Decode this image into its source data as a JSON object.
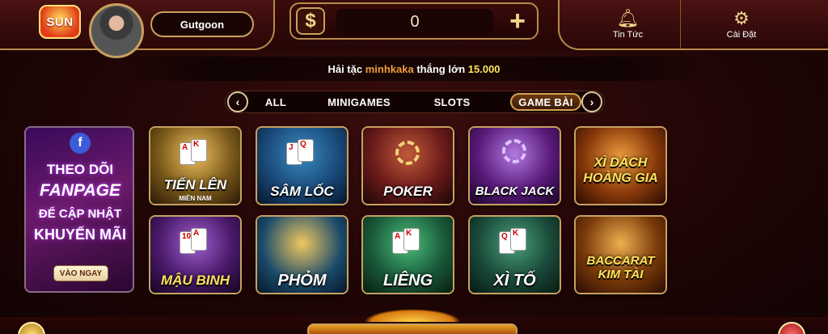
{
  "header": {
    "logo_text": "SUN",
    "username": "Gutgoon",
    "balance": "0",
    "currency_symbol": "$",
    "add_symbol": "+",
    "news_label": "Tin Tức",
    "settings_label": "Cài Đặt"
  },
  "ticker": {
    "prefix": "Hải tặc",
    "player": "minhkaka",
    "verb": "thắng lớn",
    "amount": "15.000"
  },
  "tabs": {
    "prev_symbol": "‹",
    "next_symbol": "›",
    "items": [
      {
        "label": "ALL"
      },
      {
        "label": "MINIGAMES"
      },
      {
        "label": "SLOTS"
      },
      {
        "label": "GAME BÀI",
        "active": true
      }
    ]
  },
  "promo": {
    "fb_letter": "f",
    "line1": "THEO DÕI",
    "line2": "FANPAGE",
    "line3": "ĐỂ CẬP NHẬT",
    "line4": "KHUYẾN MÃI",
    "button": "VÀO NGAY"
  },
  "games": [
    {
      "title": "TIẾN LÊN",
      "subtitle": "MIỀN NAM",
      "color": "#7a5a1a"
    },
    {
      "title": "SÂM LỐC",
      "subtitle": "",
      "color": "#1a4a7a"
    },
    {
      "title": "POKER",
      "subtitle": "",
      "color": "#6a1a1a"
    },
    {
      "title": "BLACK JACK",
      "subtitle": "",
      "color": "#5a1a7a"
    },
    {
      "title": "XÌ DÁCH HOÀNG GIA",
      "subtitle": "",
      "color": "#8a3a0a"
    },
    {
      "title": "MẬU BINH",
      "subtitle": "",
      "color": "#4a1a6a"
    },
    {
      "title": "PHỎM",
      "subtitle": "",
      "color": "#1a4a6a"
    },
    {
      "title": "LIÊNG",
      "subtitle": "",
      "color": "#1a5a3a"
    },
    {
      "title": "XÌ TỐ",
      "subtitle": "",
      "color": "#1a4a3a"
    },
    {
      "title": "BACCARAT KIM TÀI",
      "subtitle": "",
      "color": "#7a3a0a"
    }
  ]
}
